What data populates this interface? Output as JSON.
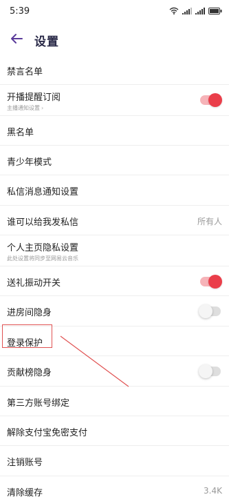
{
  "status_bar": {
    "time": "5:39",
    "icons": [
      "wifi-icon",
      "signal-icon",
      "signal-icon",
      "battery-icon"
    ]
  },
  "header": {
    "back_icon": "arrow-left-icon",
    "title": "设置"
  },
  "settings": [
    {
      "label": "禁言名单"
    },
    {
      "label": "开播提醒订阅",
      "sub": "主播通知设置",
      "toggle": true
    },
    {
      "label": "黑名单"
    },
    {
      "label": "青少年模式"
    },
    {
      "label": "私信消息通知设置"
    },
    {
      "label": "谁可以给我发私信",
      "value": "所有人"
    },
    {
      "label": "个人主页隐私设置",
      "sub": "此处设置将同步至网易云音乐"
    },
    {
      "label": "送礼振动开关",
      "toggle": true
    },
    {
      "label": "进房间隐身",
      "toggle": false
    },
    {
      "label": "登录保护"
    },
    {
      "label": "贡献榜隐身",
      "toggle": false
    },
    {
      "label": "第三方账号绑定"
    },
    {
      "label": "解除支付宝免密支付"
    },
    {
      "label": "注销账号"
    },
    {
      "label": "清除缓存",
      "value": "3.4K"
    }
  ],
  "colors": {
    "accent": "#ea3e4a",
    "accent_track": "#f6b3b8",
    "title": "#2a2a48",
    "back_arrow": "#5a3a9a",
    "annotation": "#e05050"
  }
}
